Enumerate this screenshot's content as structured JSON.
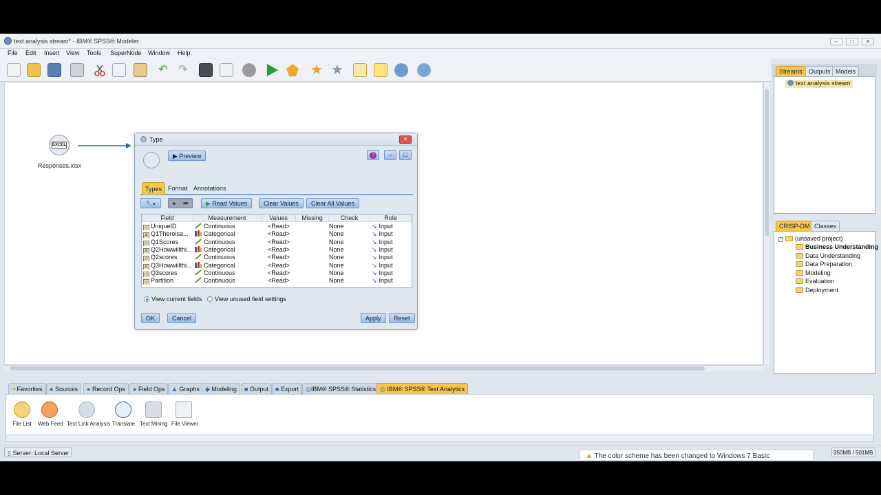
{
  "window": {
    "title": "text analysis stream* - IBM® SPSS® Modeler",
    "min": "–",
    "max": "□",
    "close": "✕"
  },
  "menu": [
    "File",
    "Edit",
    "Insert",
    "View",
    "Tools",
    "SuperNode",
    "Window",
    "Help"
  ],
  "toolbar_icons": [
    "new-stream-icon",
    "open-icon",
    "save-icon",
    "print-icon",
    "cut-icon",
    "copy-icon",
    "paste-icon",
    "undo-icon",
    "redo-icon",
    "find-icon",
    "edit-icon",
    "stop-icon",
    "run-icon",
    "run-selection-icon",
    "star-icon",
    "favorite-icon",
    "annotation-icon",
    "comment-icon",
    "zoom-icon",
    "preview-icon"
  ],
  "canvas": {
    "source_node_label": "Responses.xlsx",
    "source_node_glyph": "EXCEL"
  },
  "right_panel": {
    "tabs_top": [
      "Streams",
      "Outputs",
      "Models"
    ],
    "stream_item": "text analysis stream",
    "tabs_bottom": [
      "CRISP-DM",
      "Classes"
    ],
    "project_root": "(unsaved project)",
    "project_items": [
      "Business Understanding",
      "Data Understanding",
      "Data Preparation",
      "Modeling",
      "Evaluation",
      "Deployment"
    ]
  },
  "dialog": {
    "title": "Type",
    "close": "✕",
    "preview_label": "Preview",
    "tabs": [
      "Types",
      "Format",
      "Annotations"
    ],
    "read_values_label": "Read Values",
    "clear_values_label": "Clear Values",
    "clear_all_values_label": "Clear All Values",
    "columns": [
      "Field",
      "Measurement",
      "Values",
      "Missing",
      "Check",
      "Role"
    ],
    "rows": [
      {
        "field": "UniqueID",
        "type_icon": "range",
        "measurement": "Continuous",
        "values": "<Read>",
        "missing": "",
        "check": "None",
        "role": "Input"
      },
      {
        "field": "Q1Thereisa...",
        "type_icon": "string",
        "measurement": "Categorical",
        "values": "<Read>",
        "missing": "",
        "check": "None",
        "role": "Input"
      },
      {
        "field": "Q1Scores",
        "type_icon": "range",
        "measurement": "Continuous",
        "values": "<Read>",
        "missing": "",
        "check": "None",
        "role": "Input"
      },
      {
        "field": "Q2Howwillthi...",
        "type_icon": "string",
        "measurement": "Categorical",
        "values": "<Read>",
        "missing": "",
        "check": "None",
        "role": "Input"
      },
      {
        "field": "Q2scores",
        "type_icon": "range",
        "measurement": "Continuous",
        "values": "<Read>",
        "missing": "",
        "check": "None",
        "role": "Input"
      },
      {
        "field": "Q3Howwillthi...",
        "type_icon": "string",
        "measurement": "Categorical",
        "values": "<Read>",
        "missing": "",
        "check": "None",
        "role": "Input"
      },
      {
        "field": "Q3scores",
        "type_icon": "range",
        "measurement": "Continuous",
        "values": "<Read>",
        "missing": "",
        "check": "None",
        "role": "Input"
      },
      {
        "field": "Partition",
        "type_icon": "range",
        "measurement": "Continuous",
        "values": "<Read>",
        "missing": "",
        "check": "None",
        "role": "Input"
      }
    ],
    "radio_current": "View current fields",
    "radio_unused": "View unused field settings",
    "ok_label": "OK",
    "cancel_label": "Cancel",
    "apply_label": "Apply",
    "reset_label": "Reset"
  },
  "palette": {
    "tabs": [
      "Favorites",
      "Sources",
      "Record Ops",
      "Field Ops",
      "Graphs",
      "Modeling",
      "Output",
      "Export",
      "IBM® SPSS® Statistics",
      "IBM® SPSS® Text Analytics"
    ],
    "active_tab": "IBM® SPSS® Text Analytics",
    "nodes": [
      "File List",
      "Web Feed",
      "Text Link Analysis",
      "Translate",
      "Text Mining",
      "File Viewer"
    ]
  },
  "status": {
    "server": "Server: Local Server",
    "notification": "The color scheme has been changed to Windows 7 Basic",
    "memory": "350MB / 501MB"
  },
  "colors": {
    "accent_tab": "#f7c64b",
    "button_blue": "#9dbde6",
    "run_green": "#2e9b2e",
    "arrow_blue": "#2f66b0"
  }
}
